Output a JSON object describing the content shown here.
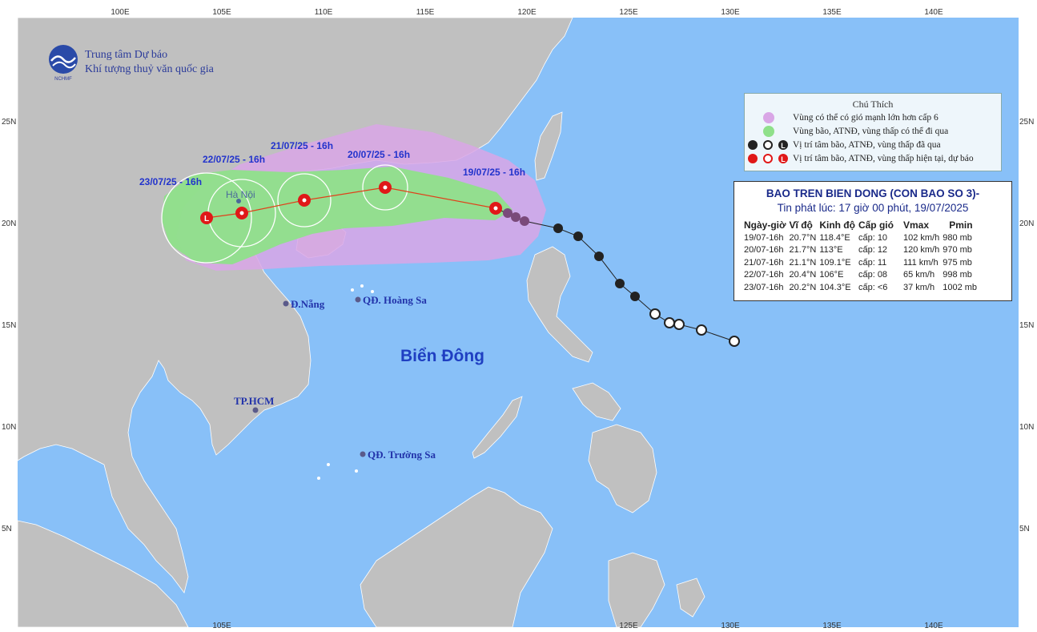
{
  "map": {
    "lon_ticks": [
      "100E",
      "105E",
      "110E",
      "115E",
      "120E",
      "125E",
      "130E",
      "135E",
      "140E"
    ],
    "lat_ticks": [
      "25N",
      "20N",
      "15N",
      "10N",
      "5N"
    ],
    "sea_label": "Biển Đông",
    "places": {
      "hanoi": "Hà Nội",
      "danang": "Đ.Nẵng",
      "hoangsa": "QĐ. Hoàng Sa",
      "hcm": "TP.HCM",
      "truongsa": "QĐ. Trường Sa"
    },
    "forecast_labels": [
      "19/07/25 - 16h",
      "20/07/25 - 16h",
      "21/07/25 - 16h",
      "22/07/25 - 16h",
      "23/07/25 - 16h"
    ],
    "colors": {
      "ocean": "#88c0f8",
      "land": "#c0c0c0",
      "strong_wind_zone": "#d9a6e6",
      "storm_zone": "#8fe08a",
      "symbol_current": "#e01818",
      "symbol_past": "#222222"
    }
  },
  "agency": {
    "line1": "Trung tâm Dự báo",
    "line2": "Khí tượng thuỷ văn quốc gia",
    "logo_text": "NCHMF"
  },
  "legend": {
    "title": "Chú Thích",
    "items": [
      "Vùng có thể có gió mạnh lớn hơn cấp 6",
      "Vùng bão, ATNĐ, vùng thấp có thể đi qua",
      "Vị trí tâm bão, ATNĐ, vùng thấp đã qua",
      "Vị trí tâm bão, ATNĐ, vùng thấp hiện tại, dự báo"
    ]
  },
  "bulletin": {
    "title": "BAO TREN BIEN DONG (CON BAO SO 3)-",
    "issued": "Tin phát lúc: 17 giờ 00 phút, 19/07/2025",
    "headers": [
      "Ngày-giờ",
      "Vĩ độ",
      "Kinh độ",
      "Cấp gió",
      "Vmax",
      "Pmin"
    ],
    "rows": [
      [
        "19/07-16h",
        "20.7°N",
        "118.4°E",
        "cấp: 10",
        "102 km/h",
        "980 mb"
      ],
      [
        "20/07-16h",
        "21.7°N",
        "113°E",
        "cấp: 12",
        "120 km/h",
        "970 mb"
      ],
      [
        "21/07-16h",
        "21.1°N",
        "109.1°E",
        "cấp: 11",
        "111 km/h",
        "975 mb"
      ],
      [
        "22/07-16h",
        "20.4°N",
        "106°E",
        "cấp: 08",
        "65 km/h",
        "998 mb"
      ],
      [
        "23/07-16h",
        "20.2°N",
        "104.3°E",
        "cấp: <6",
        "37 km/h",
        "1002 mb"
      ]
    ]
  }
}
